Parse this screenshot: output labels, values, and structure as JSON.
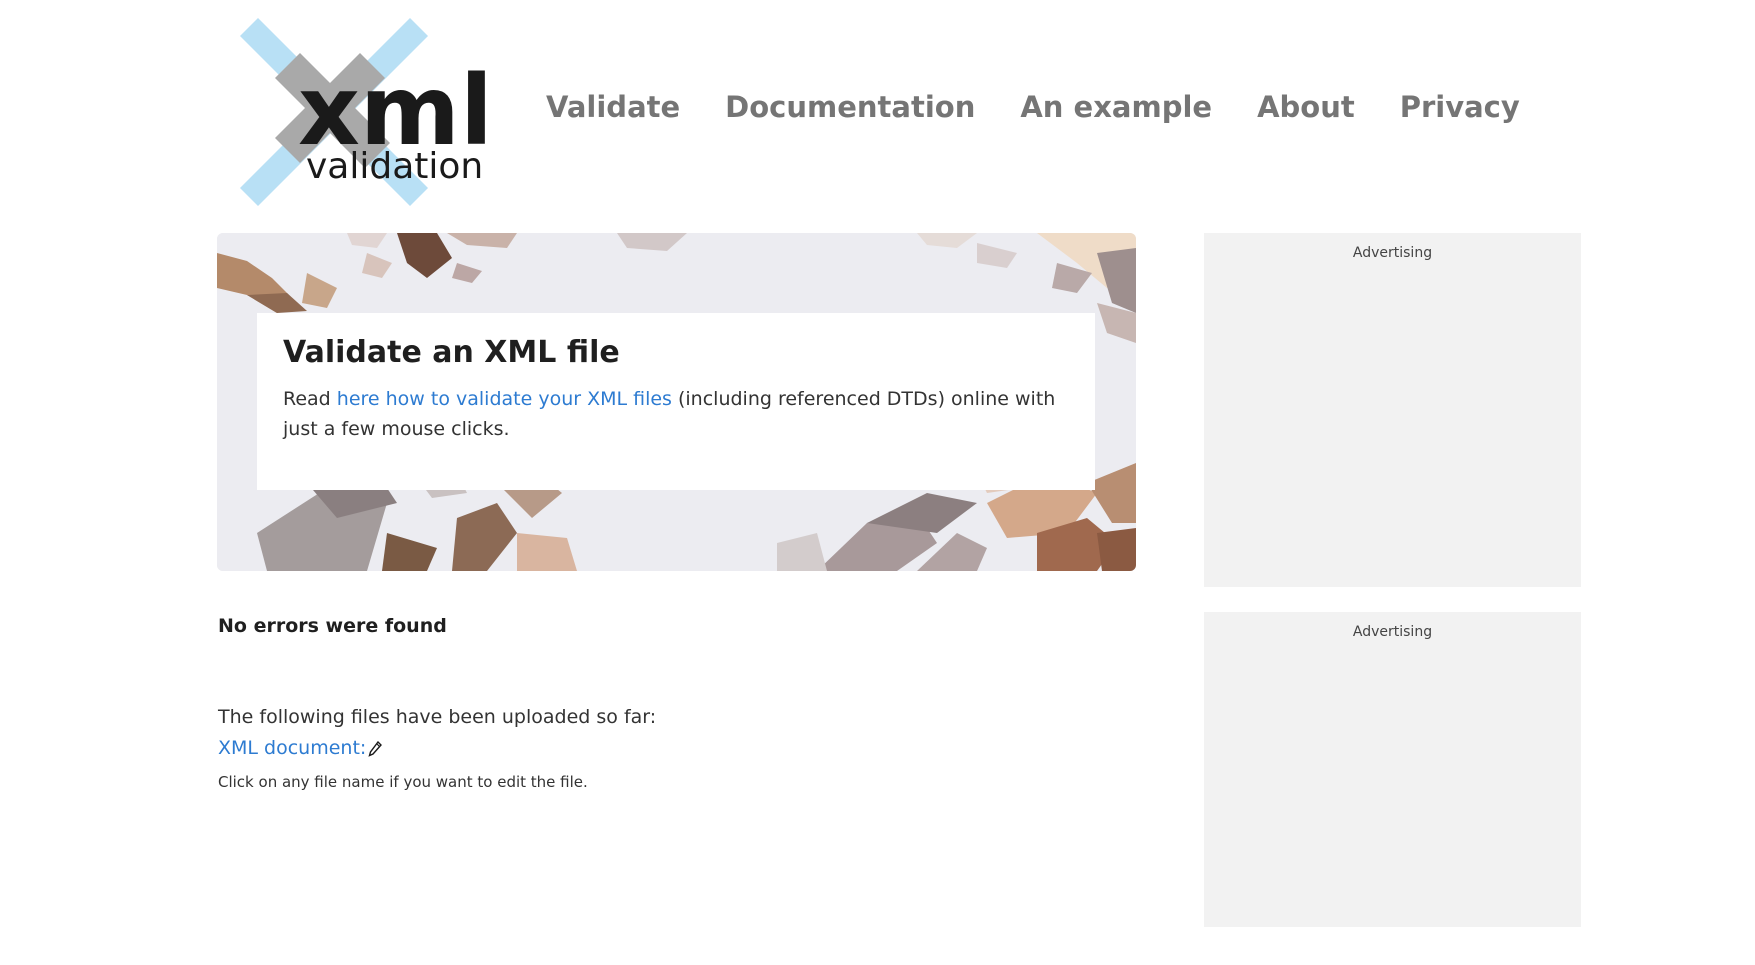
{
  "logo": {
    "text_main": "xml",
    "text_sub": "validation",
    "colors": {
      "cross_light": "#b8e0f5",
      "cross_dark": "#a9a9a9",
      "text": "#1a1a1a"
    }
  },
  "nav": {
    "items": [
      {
        "label": "Validate"
      },
      {
        "label": "Documentation"
      },
      {
        "label": "An example"
      },
      {
        "label": "About"
      },
      {
        "label": "Privacy"
      }
    ]
  },
  "hero": {
    "title": "Validate an XML file",
    "text_before": "Read ",
    "link_text": "here how to validate your XML files",
    "text_after": " (including referenced DTDs) online with just a few mouse clicks."
  },
  "results": {
    "status": "No errors were found",
    "files_intro": "The following files have been uploaded so far:",
    "file_link": "XML document:",
    "file_icon": "pencil-icon",
    "hint": "Click on any file name if you want to edit the file."
  },
  "ads": [
    {
      "label": "Advertising"
    },
    {
      "label": "Advertising"
    }
  ],
  "colors": {
    "link": "#2d7bd1",
    "nav": "#757575",
    "ad_background": "#f2f2f2"
  }
}
